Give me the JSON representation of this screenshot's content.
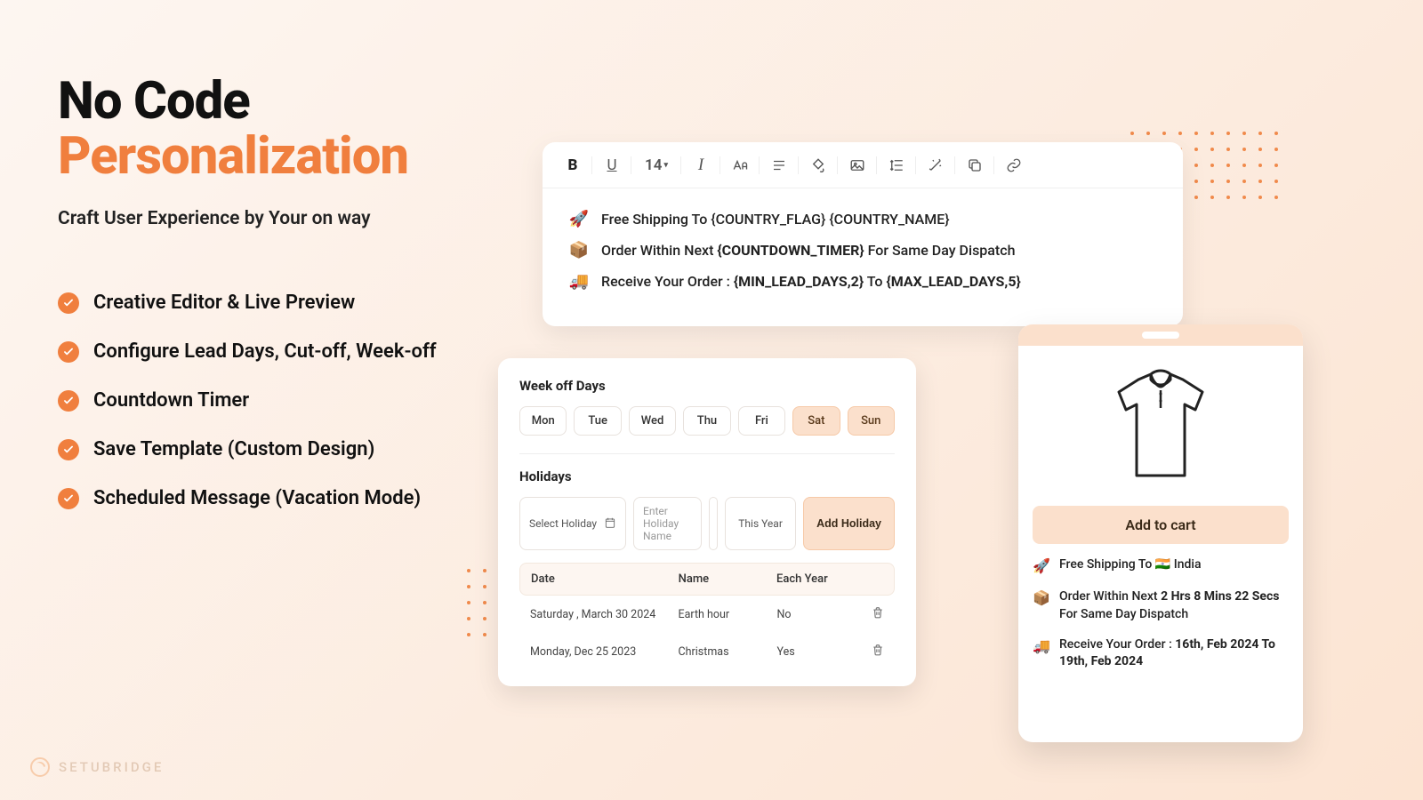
{
  "headline": {
    "line1": "No Code",
    "line2": "Personalization"
  },
  "subtitle": "Craft User Experience by Your on way",
  "features": [
    "Creative Editor & Live Preview",
    "Configure Lead Days, Cut-off, Week-off",
    "Countdown Timer",
    "Save Template (Custom Design)",
    "Scheduled Message (Vacation Mode)"
  ],
  "toolbar": {
    "bold": "B",
    "underline": "U",
    "size": "14",
    "italic": "I"
  },
  "editor": {
    "line1": "Free Shipping To {COUNTRY_FLAG} {COUNTRY_NAME}",
    "line2_pre": "Order Within Next ",
    "line2_token": "{COUNTDOWN_TIMER}",
    "line2_post": " For Same Day Dispatch",
    "line3_pre": "Receive Your Order :  ",
    "line3_token1": "{MIN_LEAD_DAYS,2}",
    "line3_mid": " To  ",
    "line3_token2": "{MAX_LEAD_DAYS,5}"
  },
  "config": {
    "weekoff_title": "Week off Days",
    "days": [
      {
        "label": "Mon",
        "on": false
      },
      {
        "label": "Tue",
        "on": false
      },
      {
        "label": "Wed",
        "on": false
      },
      {
        "label": "Thu",
        "on": false
      },
      {
        "label": "Fri",
        "on": false
      },
      {
        "label": "Sat",
        "on": true
      },
      {
        "label": "Sun",
        "on": true
      }
    ],
    "holidays_title": "Holidays",
    "select_holiday": "Select Holiday",
    "enter_name_ph": "Enter Holiday Name",
    "this_year": "This Year",
    "add_btn": "Add Holiday",
    "headers": {
      "date": "Date",
      "name": "Name",
      "each": "Each Year"
    },
    "rows": [
      {
        "date": "Saturday , March 30 2024",
        "name": "Earth hour",
        "each": "No"
      },
      {
        "date": "Monday, Dec  25  2023",
        "name": "Christmas",
        "each": "Yes"
      }
    ]
  },
  "phone": {
    "add_to_cart": "Add to cart",
    "l1_pre": "Free Shipping To  ",
    "l1_flag": "🇮🇳",
    "l1_country": "  India",
    "l2_pre": "Order Within Next ",
    "l2_timer": "2 Hrs 8 Mins 22 Secs",
    "l2_post": " For Same Day Dispatch",
    "l3_pre": "Receive Your Order :  ",
    "l3_range": "16th, Feb 2024 To 19th, Feb 2024"
  },
  "brand": "SETUBRIDGE"
}
